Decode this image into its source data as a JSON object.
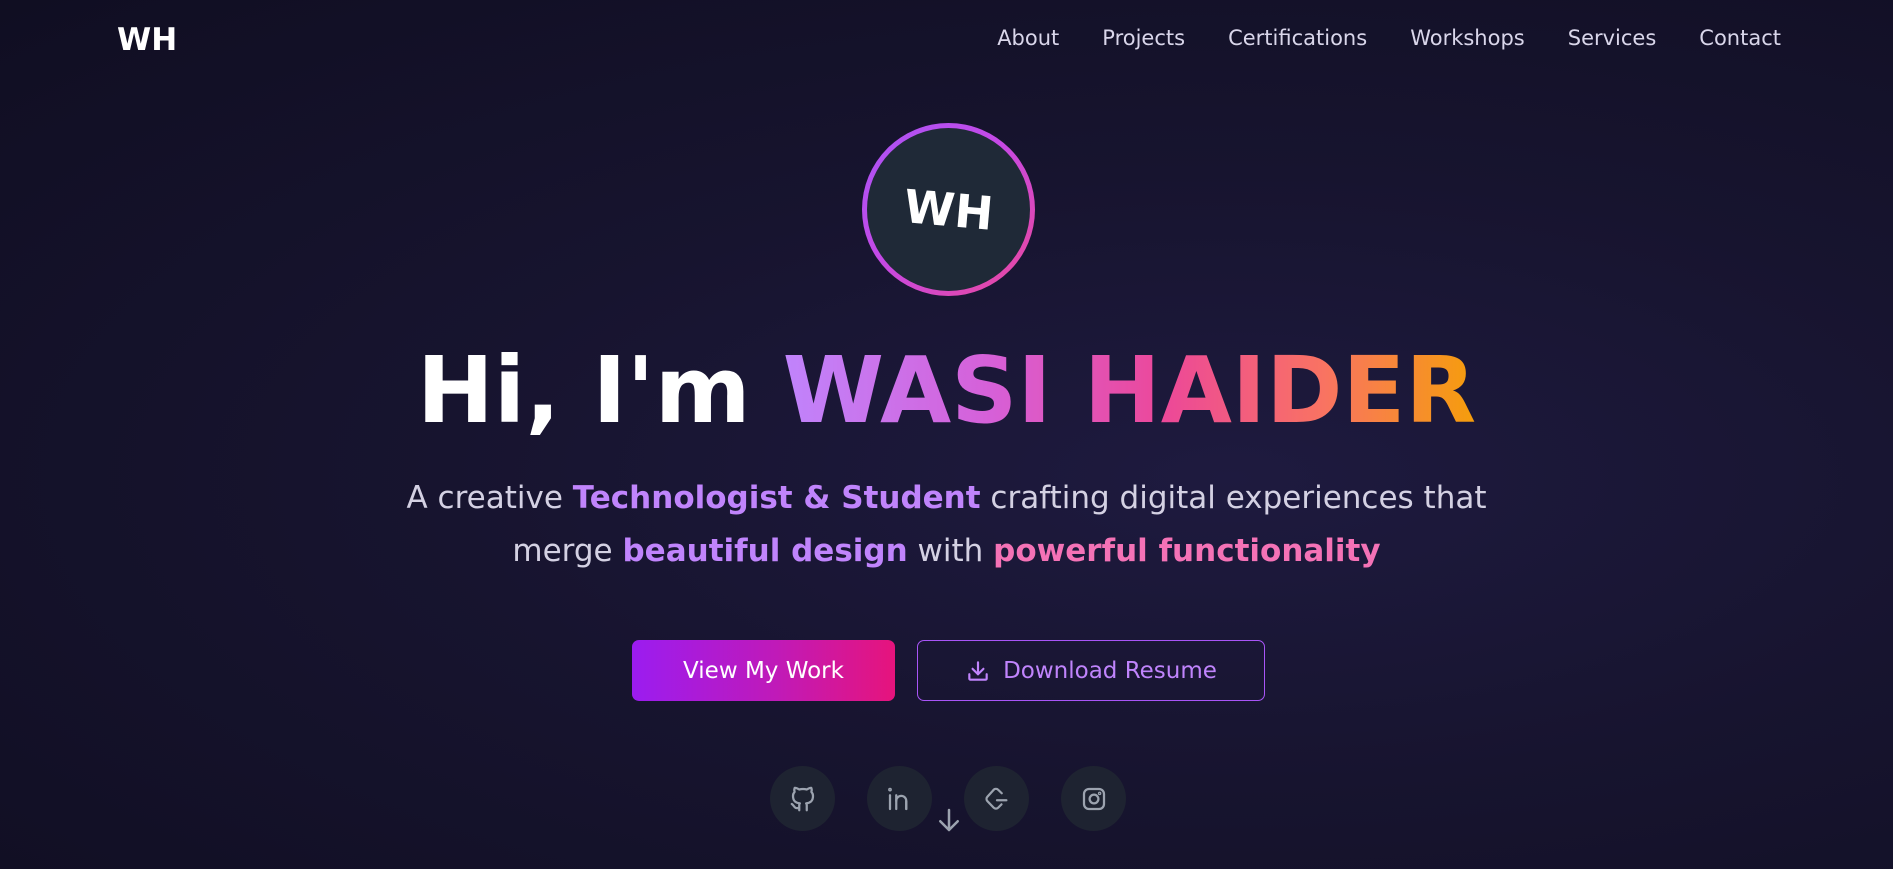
{
  "brand": {
    "logo": "WH"
  },
  "nav": {
    "links": [
      "About",
      "Projects",
      "Certifications",
      "Workshops",
      "Services",
      "Contact"
    ]
  },
  "avatar": {
    "initials": "WH"
  },
  "hero": {
    "greeting": "Hi, I'm ",
    "name": "WASI HAIDER",
    "subtitle": {
      "part1": "A creative ",
      "role": "Technologist & Student",
      "part2": " crafting digital experiences that",
      "part3": "merge ",
      "highlight1": "beautiful design",
      "part4": " with ",
      "highlight2": "powerful functionality"
    }
  },
  "buttons": {
    "primary": "View My Work",
    "secondary": "Download Resume"
  },
  "socials": [
    {
      "icon": "github-icon"
    },
    {
      "icon": "linkedin-icon"
    },
    {
      "icon": "leetcode-icon"
    },
    {
      "icon": "instagram-icon"
    }
  ],
  "colors": {
    "background": "#14122b",
    "accent_purple": "#a855f7",
    "accent_pink": "#ec4899",
    "accent_orange": "#f59e0b"
  }
}
